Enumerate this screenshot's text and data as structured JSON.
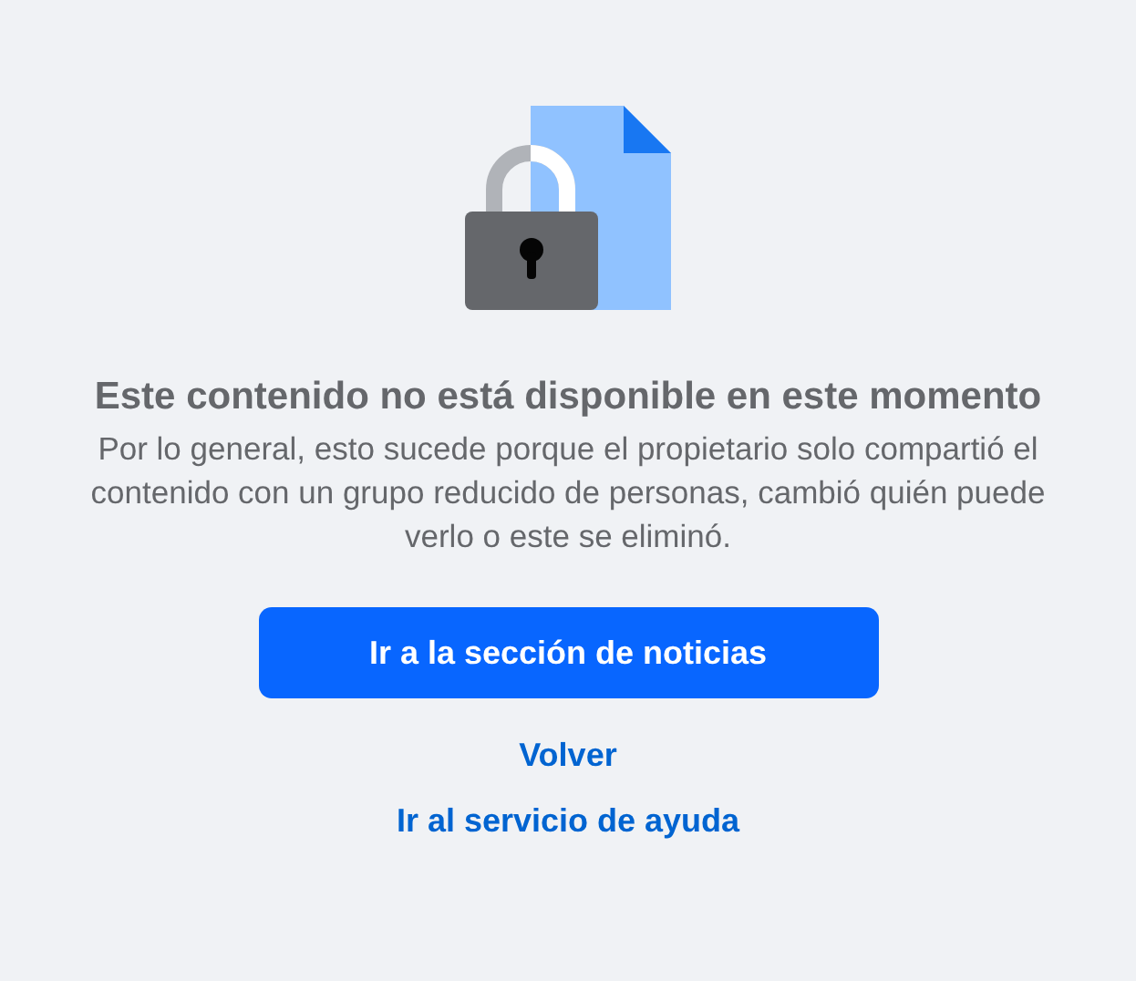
{
  "title": "Este contenido no está disponible en este momento",
  "message": "Por lo general, esto sucede porque el propietario solo compartió el contenido con un grupo reducido de personas, cambió quién puede verlo o este se eliminó.",
  "primary_button": "Ir a la sección de noticias",
  "links": [
    "Volver",
    "Ir al servicio de ayuda"
  ]
}
